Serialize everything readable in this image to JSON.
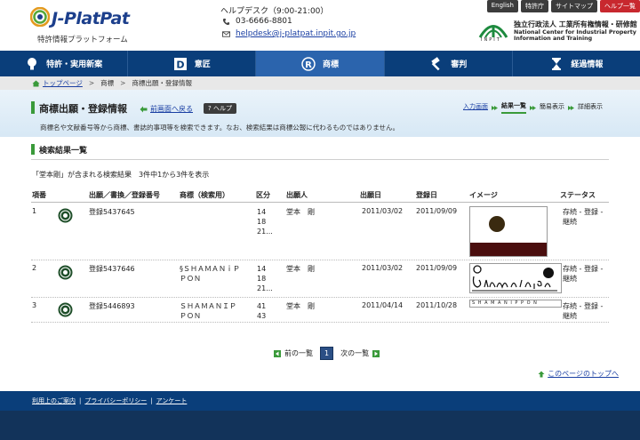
{
  "header": {
    "logo_text": "J-PlatPat",
    "logo_sub": "特許情報プラットフォーム",
    "helpdesk_title": "ヘルプデスク（9:00-21:00）",
    "phone": "03-6666-8801",
    "email": "helpdesk@j-platpat.inpit.go.jp",
    "toplinks": [
      "English",
      "特許庁",
      "サイトマップ",
      "ヘルプ一覧"
    ],
    "org_inpit": "INPIT",
    "org_jp": "独立行政法人 工業所有権情報・研修館",
    "org_en1": "National Center for Industrial Property",
    "org_en2": "Information and Training"
  },
  "nav": {
    "items": [
      "特許・実用新案",
      "意匠",
      "商標",
      "審判",
      "経過情報"
    ],
    "active_index": 2
  },
  "breadcrumb": {
    "home": "トップページ",
    "level1": "商標",
    "level2": "商標出願・登録情報"
  },
  "titleband": {
    "title": "商標出願・登録情報",
    "back": "前画面へ戻る",
    "help": "ヘルプ",
    "description": "商標名や文献番号等から商標、書誌的事項等を検索できます。なお、検索結果は商標公報に代わるものではありません。",
    "steps": [
      "入力画面",
      "結果一覧",
      "簡易表示",
      "詳細表示"
    ],
    "current_step": 1
  },
  "section": {
    "title": "検索結果一覧",
    "summary": "「堂本剛」が含まれる検索結果　3件中1から3件を表示"
  },
  "table": {
    "headers": [
      "項番",
      "出願／書換／登録番号",
      "商標（検索用）",
      "区分",
      "出願人",
      "出願日",
      "登録日",
      "イメージ",
      "ステータス"
    ],
    "rows": [
      {
        "no": "1",
        "reg": "登録5437645",
        "mark": "",
        "classes": [
          "14",
          "18",
          "21..."
        ],
        "applicant": "堂本　剛",
        "filed": "2011/03/02",
        "registered": "2011/09/09",
        "status1": "存続 - 登録 -",
        "status2": "継続",
        "image": "circle-bar"
      },
      {
        "no": "2",
        "reg": "登録5437646",
        "mark1": "§ＳＨＡＭＡＮｉＰ",
        "mark2": "ＰＯＮ",
        "classes": [
          "14",
          "18",
          "21..."
        ],
        "applicant": "堂本　剛",
        "filed": "2011/03/02",
        "registered": "2011/09/09",
        "status1": "存続 - 登録 -",
        "status2": "継続",
        "image": "handwritten"
      },
      {
        "no": "3",
        "reg": "登録5446893",
        "mark1": "ＳＨＡＭＡＮＩＰ",
        "mark2": "ＰＯＮ",
        "classes": [
          "41",
          "43"
        ],
        "applicant": "堂本　剛",
        "filed": "2011/04/14",
        "registered": "2011/10/28",
        "status1": "存続 - 登録 -",
        "status2": "継続",
        "image_text": "S H A M A N I P P O N"
      }
    ]
  },
  "pager": {
    "prev": "前の一覧",
    "page": "1",
    "next": "次の一覧"
  },
  "totop": "このページのトップへ",
  "footer": {
    "links": [
      "利用上のご案内",
      "プライバシーポリシー",
      "アンケート"
    ]
  },
  "colors": {
    "nav": "#0a3e7a",
    "nav_active": "#2b64ad",
    "accent_green": "#3a9a3a",
    "link": "#1a3fa3",
    "visited": "#6a1b7a"
  }
}
